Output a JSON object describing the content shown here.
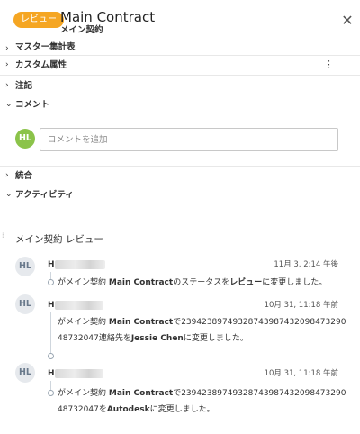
{
  "header": {
    "badge": "レビュー",
    "title": "Main Contract",
    "subtitle": "メイン契約",
    "close_icon": "close-icon"
  },
  "sections": {
    "master": "マスター集計表",
    "custom": "カスタム属性",
    "notes": "注記",
    "comments": "コメント",
    "integration": "統合",
    "activity": "アクティビティ"
  },
  "comment": {
    "avatar": "HL",
    "placeholder": "コメントを追加"
  },
  "activity": {
    "heading": "メイン契約 レビュー",
    "items": [
      {
        "avatar": "HL",
        "name_prefix": "H",
        "time": "11月 3, 2:14 午後",
        "text_1": "がメイン契約 ",
        "text_2": "Main Contract",
        "text_3": "のステータスを",
        "text_4": "レビュー",
        "text_5": "に変更しました。"
      },
      {
        "avatar": "HL",
        "name_prefix": "H",
        "time": "10月 31, 11:18 午前",
        "text_1": "がメイン契約 ",
        "text_2": "Main Contract",
        "text_3": "で",
        "text_4": "23942389749328743987432098473290487320​47",
        "text_5": "連絡先を",
        "text_6": "Jessie Chen",
        "text_7": "に変更しました。"
      },
      {
        "avatar": "HL",
        "name_prefix": "H",
        "time": "10月 31, 11:18 午前",
        "text_1": "がメイン契約 ",
        "text_2": "Main Contract",
        "text_3": "で",
        "text_4": "23942389749328743987432098473290487320​47",
        "text_5": "を",
        "text_6": "Autodesk",
        "text_7": "に変更しました。"
      }
    ]
  },
  "colors": {
    "badge": "#f5a623",
    "avatar_green": "#8bc34a",
    "avatar_gray": "#e6e9ed"
  }
}
